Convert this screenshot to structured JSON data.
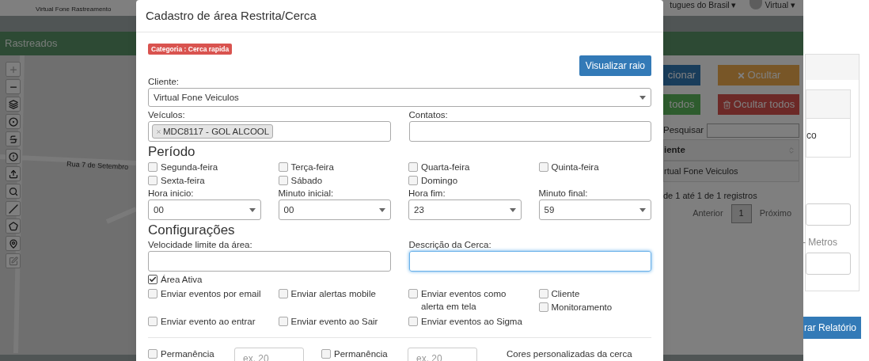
{
  "app_header": {
    "subtitle": "Virtual Fone Rastreamento",
    "language": "tugues do Brasil ▾",
    "user": "Virtual ▾"
  },
  "panel_title": "Rastreados",
  "map": {
    "street": "Rua 7 de Setembro"
  },
  "side_panel": {
    "buttons": [
      {
        "label": "cionar",
        "kind": "primary"
      },
      {
        "label": "Ocultar",
        "kind": "warning"
      },
      {
        "label": "todos",
        "kind": "success"
      },
      {
        "label": "Ocultar todos",
        "kind": "danger"
      }
    ],
    "search_label": "Pesquisar",
    "column": "iente",
    "row": "rtual Fone Veiculos",
    "info": "de 1 até 1 de 1 registros",
    "pagination": {
      "previous": "Anterior",
      "pages": [
        {
          "label": "1",
          "selected": true
        }
      ],
      "next": "Próximo"
    }
  },
  "report_page": {
    "texts": [
      "co",
      "- Metros"
    ],
    "button": "rar Relatório"
  },
  "modal": {
    "title": "Cadastro de área Restrita/Cerca",
    "badge": "Categoria : Cerca rapida",
    "view_button": "Visualizar raio",
    "client": {
      "label": "Cliente:",
      "value": "Virtual Fone Veiculos"
    },
    "vehicles": {
      "label": "Veículos:",
      "tags": [
        "MDC8117 - GOL ALCOOL"
      ]
    },
    "contacts": {
      "label": "Contatos:"
    },
    "period_title": "Período",
    "days": [
      {
        "label": "Segunda-feira",
        "checked": false
      },
      {
        "label": "Terça-feira",
        "checked": false
      },
      {
        "label": "Quarta-feira",
        "checked": false
      },
      {
        "label": "Quinta-feira",
        "checked": false
      },
      {
        "label": "Sexta-feira",
        "checked": false
      },
      {
        "label": "Sábado",
        "checked": false
      },
      {
        "label": "Domingo",
        "checked": false
      }
    ],
    "times": [
      {
        "label": "Hora inicio:",
        "value": "00"
      },
      {
        "label": "Minuto inicial:",
        "value": "00"
      },
      {
        "label": "Hora fim:",
        "value": "23"
      },
      {
        "label": "Minuto final:",
        "value": "59"
      }
    ],
    "config_title": "Configurações",
    "speed": {
      "label": "Velocidade limite da área:"
    },
    "description": {
      "label": "Descrição da Cerca:",
      "focused": true
    },
    "area_active": {
      "label": "Área Ativa",
      "checked": true
    },
    "event_options": [
      [
        {
          "label": "Enviar eventos por email",
          "checked": false
        }
      ],
      [
        {
          "label": "Enviar alertas mobile",
          "checked": false
        }
      ],
      [
        {
          "label": "Enviar eventos como alerta em tela",
          "checked": false
        }
      ],
      [
        {
          "label": "Cliente",
          "checked": false
        },
        {
          "label": "Monitoramento",
          "checked": false
        }
      ],
      [
        {
          "label": "Enviar evento ao entrar",
          "checked": false
        }
      ],
      [
        {
          "label": "Enviar evento ao Sair",
          "checked": false
        }
      ],
      [
        {
          "label": "Enviar eventos ao Sigma",
          "checked": false
        }
      ]
    ],
    "permanence": [
      {
        "label": "Permanência",
        "checked": false,
        "placeholder": "ex. 20"
      },
      {
        "label": "Permanência",
        "checked": false,
        "placeholder": "ex. 20"
      }
    ],
    "colors_label": "Cores personalizadas da cerca"
  }
}
